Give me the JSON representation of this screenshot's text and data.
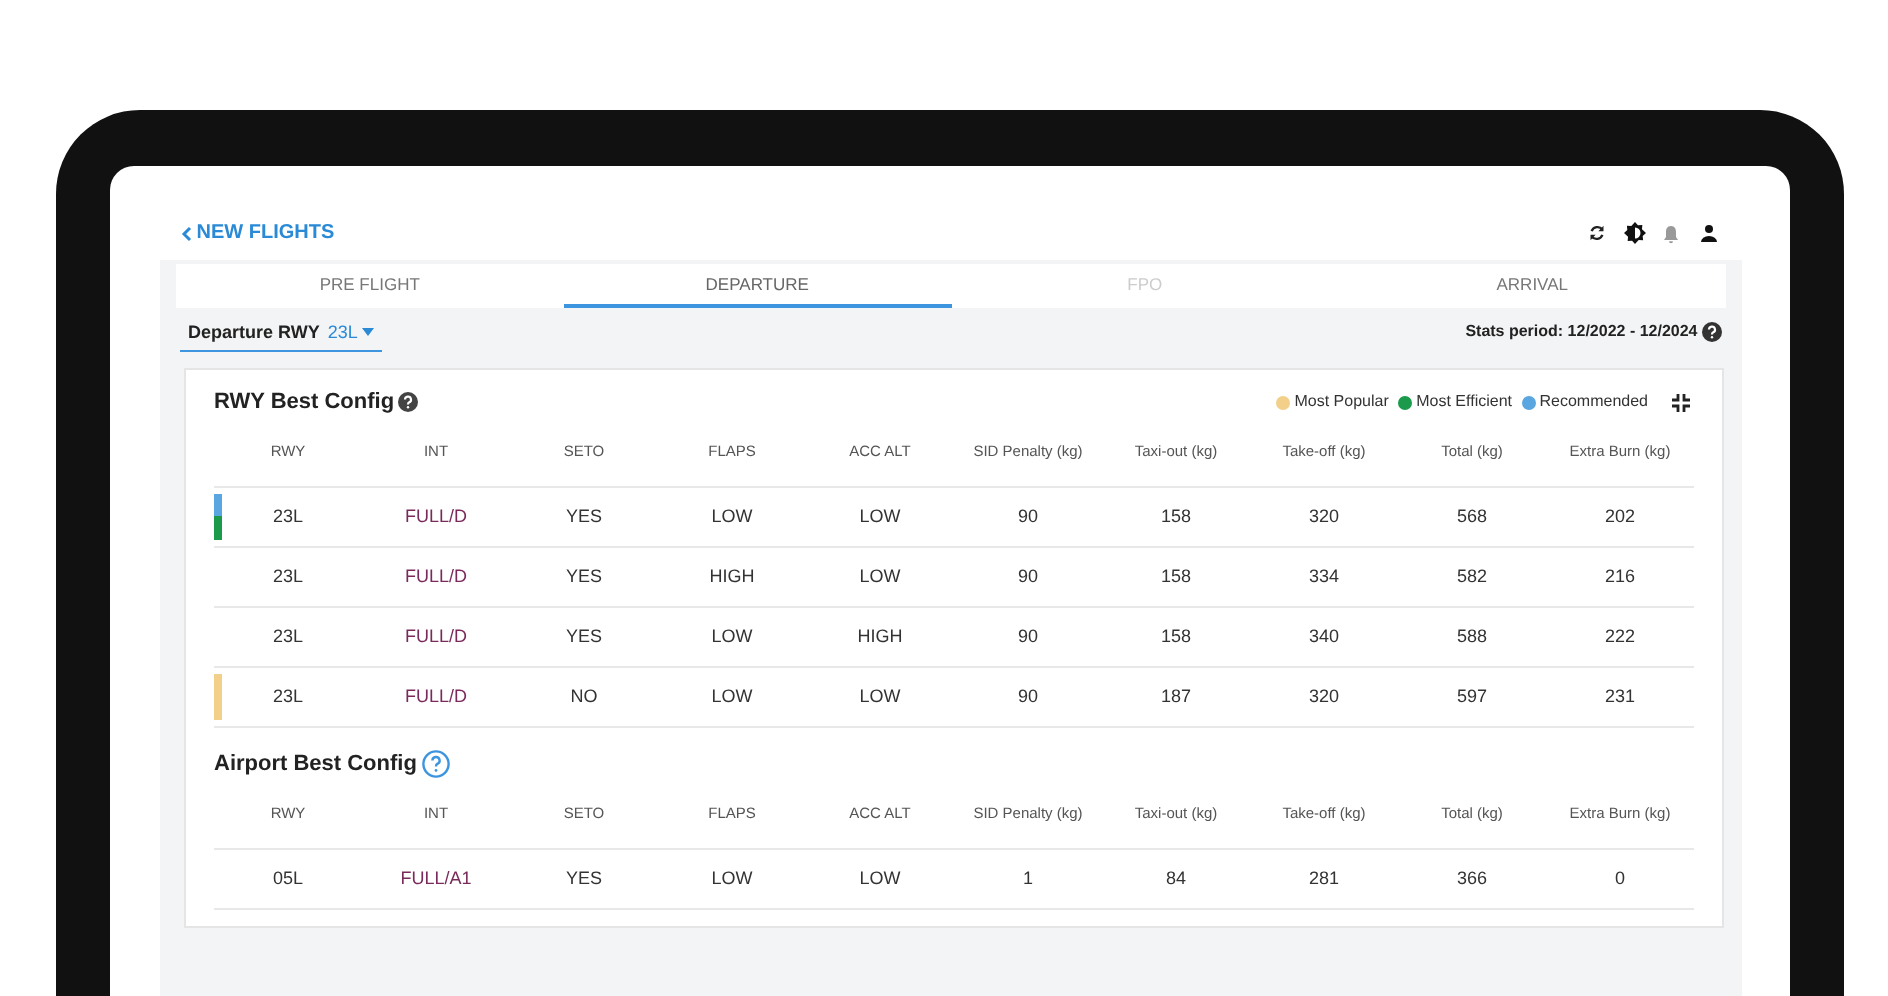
{
  "header": {
    "back_label": "NEW FLIGHTS"
  },
  "tabs": [
    {
      "label": "PRE FLIGHT",
      "selected": false,
      "disabled": false
    },
    {
      "label": "DEPARTURE",
      "selected": true,
      "disabled": false
    },
    {
      "label": "FPO",
      "selected": false,
      "disabled": true
    },
    {
      "label": "ARRIVAL",
      "selected": false,
      "disabled": false
    }
  ],
  "runway_select": {
    "label": "Departure RWY",
    "value": "23L"
  },
  "stats_period": "Stats period: 12/2022 - 12/2024",
  "sections": [
    {
      "title": "RWY Best Config",
      "kind": "solid",
      "legend": [
        {
          "label": "Most Popular",
          "color": "#f2d08a"
        },
        {
          "label": "Most Efficient",
          "color": "#1a9a4a"
        },
        {
          "label": "Recommended",
          "color": "#5aa6e0"
        }
      ],
      "columns": [
        "RWY",
        "INT",
        "SETO",
        "FLAPS",
        "ACC ALT",
        "SID Penalty (kg)",
        "Taxi-out (kg)",
        "Take-off (kg)",
        "Total (kg)",
        "Extra Burn (kg)"
      ],
      "rows": [
        {
          "markers": [
            {
              "color": "#5aa6e0"
            },
            {
              "color": "#1a9a4a"
            }
          ],
          "cells": [
            "23L",
            "FULL/D",
            "YES",
            "LOW",
            "LOW",
            "90",
            "158",
            "320",
            "568",
            "202"
          ]
        },
        {
          "markers": [],
          "cells": [
            "23L",
            "FULL/D",
            "YES",
            "HIGH",
            "LOW",
            "90",
            "158",
            "334",
            "582",
            "216"
          ]
        },
        {
          "markers": [],
          "cells": [
            "23L",
            "FULL/D",
            "YES",
            "LOW",
            "HIGH",
            "90",
            "158",
            "340",
            "588",
            "222"
          ]
        },
        {
          "markers": [
            {
              "color": "#f2d08a"
            }
          ],
          "cells": [
            "23L",
            "FULL/D",
            "NO",
            "LOW",
            "LOW",
            "90",
            "187",
            "320",
            "597",
            "231"
          ]
        }
      ]
    },
    {
      "title": "Airport Best Config",
      "kind": "outline",
      "columns": [
        "RWY",
        "INT",
        "SETO",
        "FLAPS",
        "ACC ALT",
        "SID Penalty (kg)",
        "Taxi-out (kg)",
        "Take-off (kg)",
        "Total (kg)",
        "Extra Burn (kg)"
      ],
      "rows": [
        {
          "markers": [],
          "cells": [
            "05L",
            "FULL/A1",
            "YES",
            "LOW",
            "LOW",
            "1",
            "84",
            "281",
            "366",
            "0"
          ]
        }
      ]
    }
  ]
}
